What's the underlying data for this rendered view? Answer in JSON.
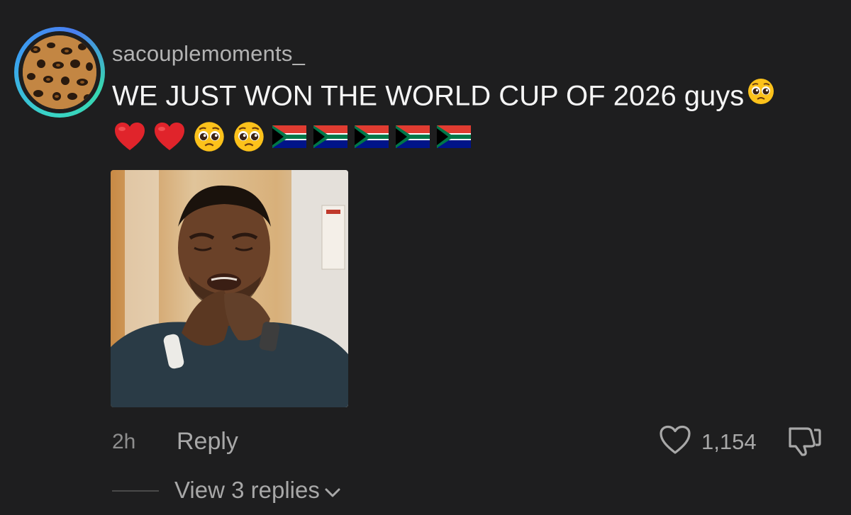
{
  "comment": {
    "username": "sacouplemoments_",
    "text": "WE JUST WON THE WORLD CUP OF 2026 guys",
    "emoji_row": [
      "red-heart",
      "red-heart",
      "pleading-face",
      "pleading-face",
      "flag-south-africa",
      "flag-south-africa",
      "flag-south-africa",
      "flag-south-africa",
      "flag-south-africa"
    ],
    "attachment": "crying-man-gif"
  },
  "meta": {
    "time": "2h",
    "reply_label": "Reply",
    "like_count": "1,154"
  },
  "replies": {
    "label": "View 3 replies"
  },
  "colors": {
    "background": "#1e1e1f",
    "text_primary": "#f5f5f5",
    "text_secondary": "#a8a8a8",
    "ring_start": "#39d3c8",
    "ring_end": "#4a7ef0"
  }
}
